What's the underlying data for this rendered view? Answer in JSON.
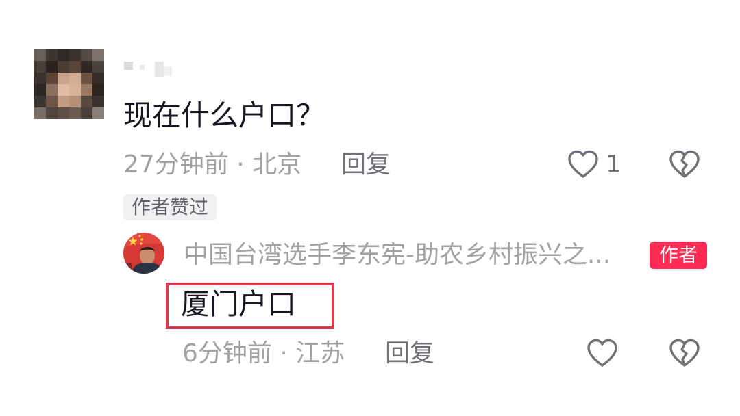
{
  "comment": {
    "text": "现在什么户口？",
    "time": "27分钟前",
    "separator": "·",
    "location": "北京",
    "reply_label": "回复",
    "like_count": "1",
    "author_liked_badge": "作者赞过"
  },
  "reply": {
    "author_name": "中国台湾选手李东宪-助农乡村振兴之...",
    "author_tag": "作者",
    "text": "厦门户口",
    "time": "6分钟前",
    "separator": "·",
    "location": "江苏",
    "reply_label": "回复"
  },
  "icons": {
    "like": "heart-outline-icon",
    "dislike": "broken-heart-icon"
  },
  "colors": {
    "primary_text": "#161823",
    "secondary_text": "#a1a1a6",
    "author_tag": "#fe2c55",
    "highlight_border": "#d8394d"
  }
}
